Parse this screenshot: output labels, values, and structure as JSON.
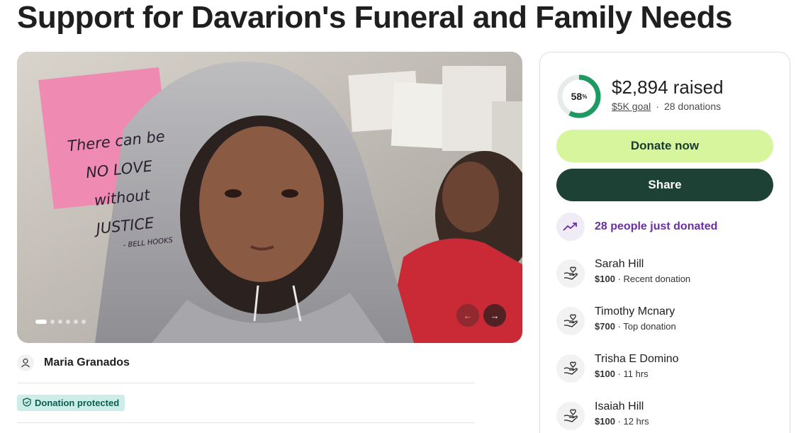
{
  "page": {
    "title": "Support for Davarion's Funeral and Family Needs"
  },
  "hero": {
    "note_lines": [
      "There can be",
      "NO LOVE",
      "without",
      "JUSTICE"
    ],
    "note_signature": "- BELL HOOKS",
    "carousel_dot_count": 6,
    "active_dot": 0,
    "prev_icon": "arrow-left-icon",
    "next_icon": "arrow-right-icon"
  },
  "organizer": {
    "name": "Maria Granados",
    "icon": "person-icon"
  },
  "badge": {
    "label": "Donation protected",
    "icon": "shield-icon"
  },
  "progress": {
    "percent": 58,
    "percent_label": "58",
    "percent_sign": "%",
    "raised_amount": "$2,894",
    "raised_word": "raised",
    "goal_label": "$5K goal",
    "separator": "·",
    "donations_label": "28 donations"
  },
  "buttons": {
    "donate_label": "Donate now",
    "share_label": "Share"
  },
  "recent": {
    "label": "28 people just donated",
    "icon": "trending-up-icon"
  },
  "donors": [
    {
      "name": "Sarah Hill",
      "amount": "$100",
      "meta": "Recent donation"
    },
    {
      "name": "Timothy Mcnary",
      "amount": "$700",
      "meta": "Top donation"
    },
    {
      "name": "Trisha E Domino",
      "amount": "$100",
      "meta": "11 hrs"
    },
    {
      "name": "Isaiah Hill",
      "amount": "$100",
      "meta": "12 hrs"
    }
  ],
  "colors": {
    "accent_green": "#d6f59c",
    "dark_green": "#1e4136",
    "progress_green": "#1c9a62",
    "purple": "#6b2fa3",
    "badge_bg": "#cdeee8"
  }
}
